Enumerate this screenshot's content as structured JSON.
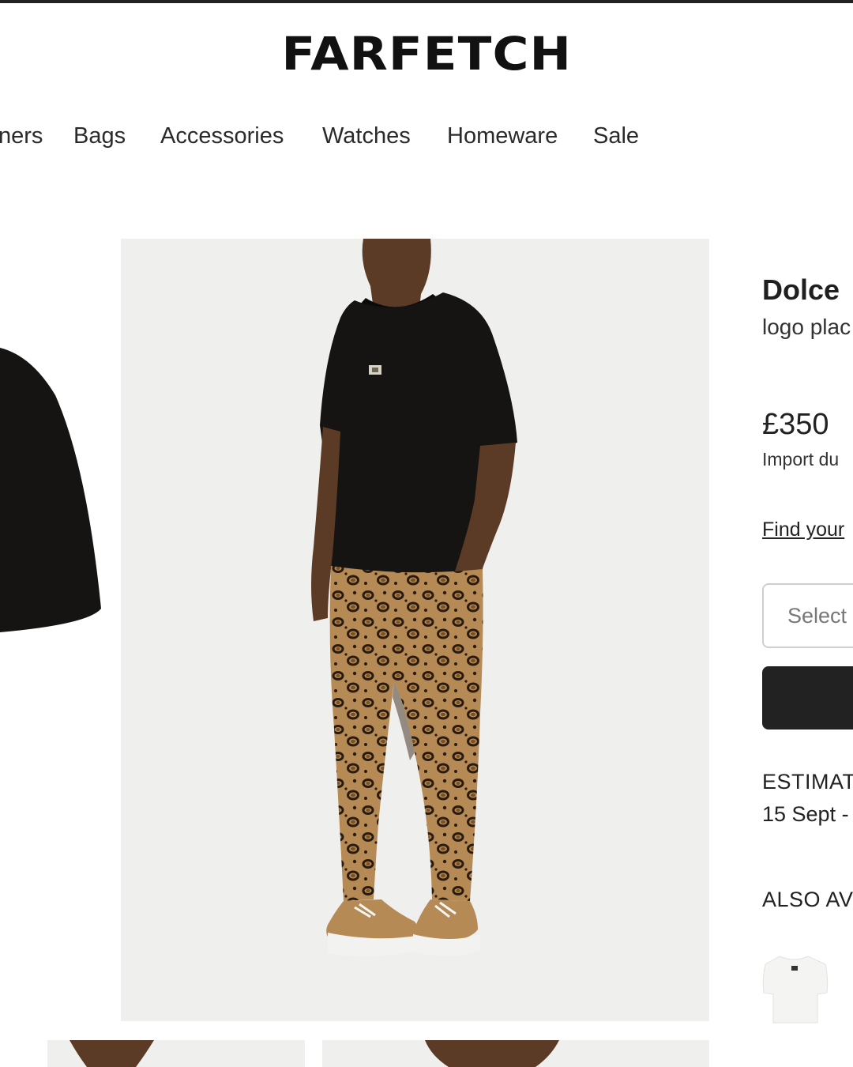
{
  "header": {
    "logo": "FARFETCH"
  },
  "nav": {
    "items": [
      {
        "label": "ners"
      },
      {
        "label": "Bags"
      },
      {
        "label": "Accessories"
      },
      {
        "label": "Watches"
      },
      {
        "label": "Homeware"
      },
      {
        "label": "Sale"
      }
    ]
  },
  "product": {
    "brand": "Dolce",
    "description": "logo plac",
    "price": "£350",
    "duties_note": "Import du",
    "size_guide_link": "Find your",
    "size_select_placeholder": "Select",
    "delivery_label": "ESTIMAT",
    "delivery_date": "15 Sept -",
    "also_available_label": "ALSO AV"
  },
  "colors": {
    "photo_background": "#efefee",
    "button": "#222222",
    "tshirt": "#161412",
    "leopard_base": "#b58a55"
  }
}
